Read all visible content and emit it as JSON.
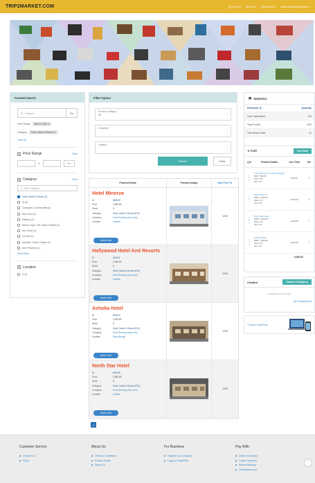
{
  "header": {
    "logo": "TRIP2MARKET.COM",
    "nav": [
      "(0) Cart (0)",
      "About Us",
      "My Account ▾",
      "admin.akshi@gmail.com ▾"
    ]
  },
  "faceted": {
    "title": "Faceted Search",
    "search_placeholder": "Search...",
    "go": "Go",
    "price_label": "Price Range",
    "price_chip": "900 to 1200 ✕",
    "category_label": "Category",
    "category_chip": "Hotel, Motel & Resort ✕",
    "clear_all": "Clear All",
    "price_section": "Price Range",
    "clear": "Clear",
    "to": "to",
    "category_section": "Category",
    "filter_placeholder": "Filter Category",
    "categories": [
      {
        "label": "Hotel, Motel & Resort (4)",
        "checked": true
      },
      {
        "label": "Ts (3)",
        "checked": false
      },
      {
        "label": "Computer & Accessories (3)",
        "checked": false
      },
      {
        "label": "Skin Care (2)",
        "checked": false
      },
      {
        "label": "Makeup (2)",
        "checked": false
      },
      {
        "label": "Electric Light, Fan setup & Repair (2)",
        "checked": false
      },
      {
        "label": "Bus Ticket (2)",
        "checked": false
      },
      {
        "label": "Lip care (1)",
        "checked": false
      },
      {
        "label": "Speaker / Home Theater (1)",
        "checked": false
      },
      {
        "label": "Men Perjafum (1)",
        "checked": false
      }
    ],
    "show_more": "Show More",
    "location_section": "Location",
    "locations": [
      "N (4)"
    ]
  },
  "filter": {
    "title": "Filter Option",
    "product_category_label": "Product Category",
    "product_category_value": "Ts",
    "company_label": "Company",
    "location_label": "Location",
    "search_btn": "Search",
    "clear_btn": "Clear"
  },
  "products": {
    "cols": [
      "Product Detail",
      "Product Image",
      "Mrp Price ⇅"
    ],
    "add_to_cart": "Add to Cart",
    "keys": [
      "ID",
      "Price",
      "Stock",
      "Category",
      "Company",
      "Location"
    ],
    "items": [
      {
        "name": "Hotel Minerva",
        "id": "818036",
        "price": "1,200.00",
        "stock": "0",
        "category": "Hotel, Motel & Resort (ES1)",
        "company": "Hotel Booking (only cars)",
        "location": "Kolkata",
        "mrp": "1200"
      },
      {
        "name": "Hollywood Hotel And Resorts",
        "id": "818041",
        "price": "1,200.00",
        "stock": "0",
        "category": "Hotel, Motel & Resort (ES1)",
        "company": "Hotel Booking (only cars)",
        "location": "Kolkata",
        "mrp": "1200"
      },
      {
        "name": "Ashoka Hotel",
        "id": "818044",
        "price": "1,200.00",
        "stock": "0",
        "category": "Hotel, Motel & Resort (ES1)",
        "company": "Hotel Booking (only cars)",
        "location": "West Bengal",
        "mrp": "1200"
      },
      {
        "name": "North Star Hotel",
        "id": "818038",
        "price": "1,200.00",
        "stock": "0",
        "category": "Hotel, Motel & Resort (ES1)",
        "company": "Hotel Booking (only cars)",
        "location": "Kolkata",
        "mrp": "1200"
      }
    ],
    "page": "1"
  },
  "stats": {
    "title": "Statistics",
    "col_left": "Particular ⇅",
    "col_right": "Quantity",
    "rows": [
      {
        "label": "Total Organisation",
        "value": "146"
      },
      {
        "label": "Total Product",
        "value": "7429"
      },
      {
        "label": "Total Whole Seller",
        "value": "41"
      }
    ]
  },
  "cart": {
    "title": "Cart",
    "detail_btn": "Cart Detail",
    "cols": [
      "Qnt",
      "Product Details",
      "Line Total",
      "Del"
    ],
    "items": [
      {
        "qty": "1",
        "name": "X 5 Hotels Pvt Ltd (West Bengal)",
        "mrp": "MRP: 300.00",
        "disc": "Disc: 0 %",
        "vat": "Vat: 0 %",
        "total": "300.00"
      },
      {
        "qty": "2",
        "name": "Hotel Minerva",
        "mrp": "MRP: 1,200.00",
        "disc": "Disc: 0 %",
        "vat": "Vat: 0 %",
        "total": "2,400.00"
      },
      {
        "qty": "1",
        "name": "North Star Hotel",
        "mrp": "MRP: 1,200.00",
        "disc": "Disc: 0 %",
        "vat": "Vat: 0 %",
        "total": "1,200.00"
      },
      {
        "qty": "2",
        "name": "Ashoka Hotel",
        "mrp": "MRP: 1,200.00",
        "disc": "Disc: 0 %",
        "vat": "Vat: 0 %",
        "total": "2,400.00"
      }
    ],
    "grand_total": "6,300.00"
  },
  "chatbot": {
    "title": "Chatbot",
    "btn": "Submit a Chat/Query",
    "empty": "Chat/Query list are empty",
    "link": "All Chat/Query"
  },
  "promo": {
    "link": "**Cloud TradePlus"
  },
  "footer": {
    "cols": [
      {
        "title": "Customer Service",
        "items": [
          "Contact Us",
          "FAQs"
        ]
      },
      {
        "title": "About Us",
        "items": [
          "Terms & Conditions",
          "Privacy Policy",
          "About Us"
        ]
      },
      {
        "title": "For Business",
        "items": [
          "Register as Company",
          "Login to TradePlus"
        ]
      },
      {
        "title": "Pay With",
        "items": [
          "Cash on Delivery",
          "Online Payment",
          "Mobile Banking",
          "Visa/Mastercard"
        ]
      }
    ]
  },
  "colors": {
    "accent": "#47b1ad",
    "header": "#e8b730",
    "product_name": "#e8522d",
    "link": "#3b8bc9"
  }
}
